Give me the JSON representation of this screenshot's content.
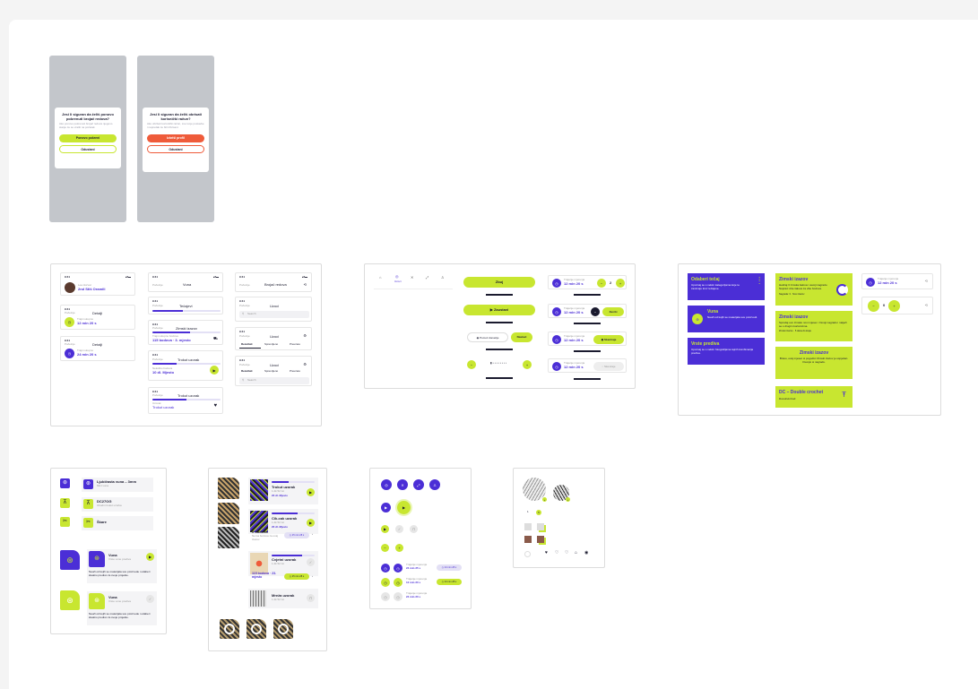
{
  "colors": {
    "primary": "#4b2ed6",
    "accent": "#c8e630",
    "danger": "#ef5b3a",
    "overlay": "#c3c6cb",
    "text": "#1a1a2e"
  },
  "modals": [
    {
      "title": "Jesi li siguran da želiš ponovo pokrenuti brojač redova?",
      "body": "Ako ponovo pokreneš brojač redova njegovo stanje će se vratiti na početak.",
      "primary": "Ponovo pokreni",
      "secondary": "Odustani"
    },
    {
      "title": "Jesi li siguran da želiš obrisati korisnički račun?",
      "body": "Ako obrišeš korisnički račun, sve tvoje postavke i napredak će biti izbrisani.",
      "primary": "Izbriši profil",
      "secondary": "Odustani"
    }
  ],
  "status_time": "9:41",
  "list_frame": {
    "profile": {
      "sub": "Lea Horvat",
      "name": "2nd Stiš Oramili"
    },
    "items": [
      {
        "tag": "Početnje",
        "title": "Detalji",
        "sub": "Trajni ukupno",
        "value": "12 min 20 s"
      },
      {
        "tag": "Početnje",
        "title": "Detalji",
        "sub": "Trajni ukupno",
        "value": "24 min 20 s"
      }
    ],
    "middle": [
      {
        "tag": "Početnje",
        "title": "Vuna"
      },
      {
        "tag": "Početnje",
        "title": "Tečajevi"
      },
      {
        "tag": "Početnje",
        "title": "Zimski izazov",
        "sub": "Trajni ukupno bodova",
        "value": "115 bodova · 3. mjesto"
      },
      {
        "tag": "Početnje",
        "title": "Trokut uzorak",
        "sub": "Nekoliko bodova",
        "value": "10 dl. Mjesto"
      },
      {
        "tag": "Početnje",
        "title": "Trokut uzorak",
        "sub": "Uzorak",
        "value": "Trokut uzorak"
      }
    ],
    "right": [
      {
        "tag": "Početnje",
        "title": "Brojač redova"
      },
      {
        "tag": "Početnje",
        "title": "Uzoci",
        "search": "Search"
      },
      {
        "tag": "Početnje",
        "title": "Uzoci",
        "tabs": [
          "Rezultati",
          "Spremljeno",
          "Preuzeto"
        ]
      },
      {
        "tag": "Početnje",
        "title": "Uzoci",
        "tabs": [
          "Rezultati",
          "Spremljeno",
          "Preuzeto"
        ],
        "search": "Search"
      }
    ]
  },
  "nav_frame": {
    "nav_label": "Uzoci",
    "buttons": {
      "start": "Zbuj",
      "pause": "Zaustavi",
      "donate": "Pomoć donacije",
      "next": "Nastavi"
    },
    "timers": [
      {
        "sub": "Trajanje mjerenja",
        "value": "12 min 20 s",
        "count": "2"
      },
      {
        "sub": "Trajanje mjerenja",
        "value": "12 min 20 s",
        "action": "Završi"
      },
      {
        "sub": "Trajanje mjerenja",
        "value": "12 min 20 s",
        "action": "Skeniraje"
      },
      {
        "sub": "Trajanje mjerenja",
        "value": "12 min 20 s",
        "action": "Skeniraje"
      }
    ]
  },
  "cards_frame": {
    "course": {
      "title": "Odaberi tečaj",
      "body": "Upoznaj se s nekim kategorijama koje te zanimaju kroz tečajeve."
    },
    "wool": {
      "title": "Vuna",
      "body": "Nauči od kojih se materijala sve proizvodi."
    },
    "yarn": {
      "title": "Vrste prediva",
      "body": "Upoznaj se s nekim fotografijama tajnih kombinacija prediva."
    },
    "winter1": {
      "title": "Zimski izazov",
      "body": "Hekiraj 3 zimska šalova i osvoji nagradu. Napravi više šalova za više bodova.",
      "foot": "Nagrada: 3 · Novi izazov"
    },
    "winter2": {
      "title": "Zimski izazov",
      "body": "Sprodaj ovo zimsko novi mjesec. Osvoji nagradu i natječi se s drugim korisnicima.",
      "foot": "Zimski izazov · 5 dana do kraja"
    },
    "winter3": {
      "title": "Zimski izazov",
      "body": "Bravo, ovaj mjesec si pogodio! Zimski izazov je uspješan. Osvojio si nagradu."
    },
    "dc": {
      "title": "DC – Double crochet",
      "body": "Dvostruki bod"
    },
    "timer": {
      "sub": "Trajanje mjerenja",
      "value": "12 min 20 s",
      "count": "0"
    }
  },
  "list_items": [
    {
      "title": "Ljubičasta vuna – 3mm",
      "sub": "Mint vuna",
      "count": "3"
    },
    {
      "title": "DC27OG",
      "sub": "Ubodni trokut uzorka"
    },
    {
      "title": "Škare"
    }
  ],
  "wool_cards": [
    {
      "title": "Vuna",
      "sub": "Vrste vune prediva",
      "body": "Nauči od kojih se materijala sve proizvode i odaberi idealno predivo za svoje projekte."
    },
    {
      "title": "Vuna",
      "sub": "Vrste vune prediva",
      "body": "Nauči od kojih se materijala sve proizvode i odaberi idealno predivo za svoje projekte."
    }
  ],
  "patterns": [
    {
      "title": "Trokut uzorak",
      "sub": "1.2k 52 Ist",
      "value": "20 dl. Mjesto"
    },
    {
      "title": "Cik-cak uzorak",
      "sub": "1.2k 52 Ist",
      "value": "20 dl. Mjesto"
    },
    {
      "title": "0 bodova",
      "sub": "Nema bodova za ovaj izazov",
      "value": "25 min 28 s"
    },
    {
      "title": "Cvjetni uzorak",
      "sub": "1.2k 52 Ist",
      "value": "115 bodova · 23. mjesto"
    },
    {
      "title": "Mreža uzorak",
      "sub": "1.2k 52 Ist"
    }
  ],
  "icon_frame": {
    "rows": [
      {
        "sub": "Trajanje mjerenja",
        "value": "24 min 25 s",
        "tag": "24 min 28 s"
      },
      {
        "sub": "Trajanje mjerenja",
        "value": "12 min 20 s",
        "tag": "24 min 28 s"
      },
      {
        "sub": "Trajanje mjerenja",
        "value": "24 min 20 s"
      }
    ]
  },
  "avatar_frame": {
    "count_a": "1",
    "count_b": "5"
  }
}
